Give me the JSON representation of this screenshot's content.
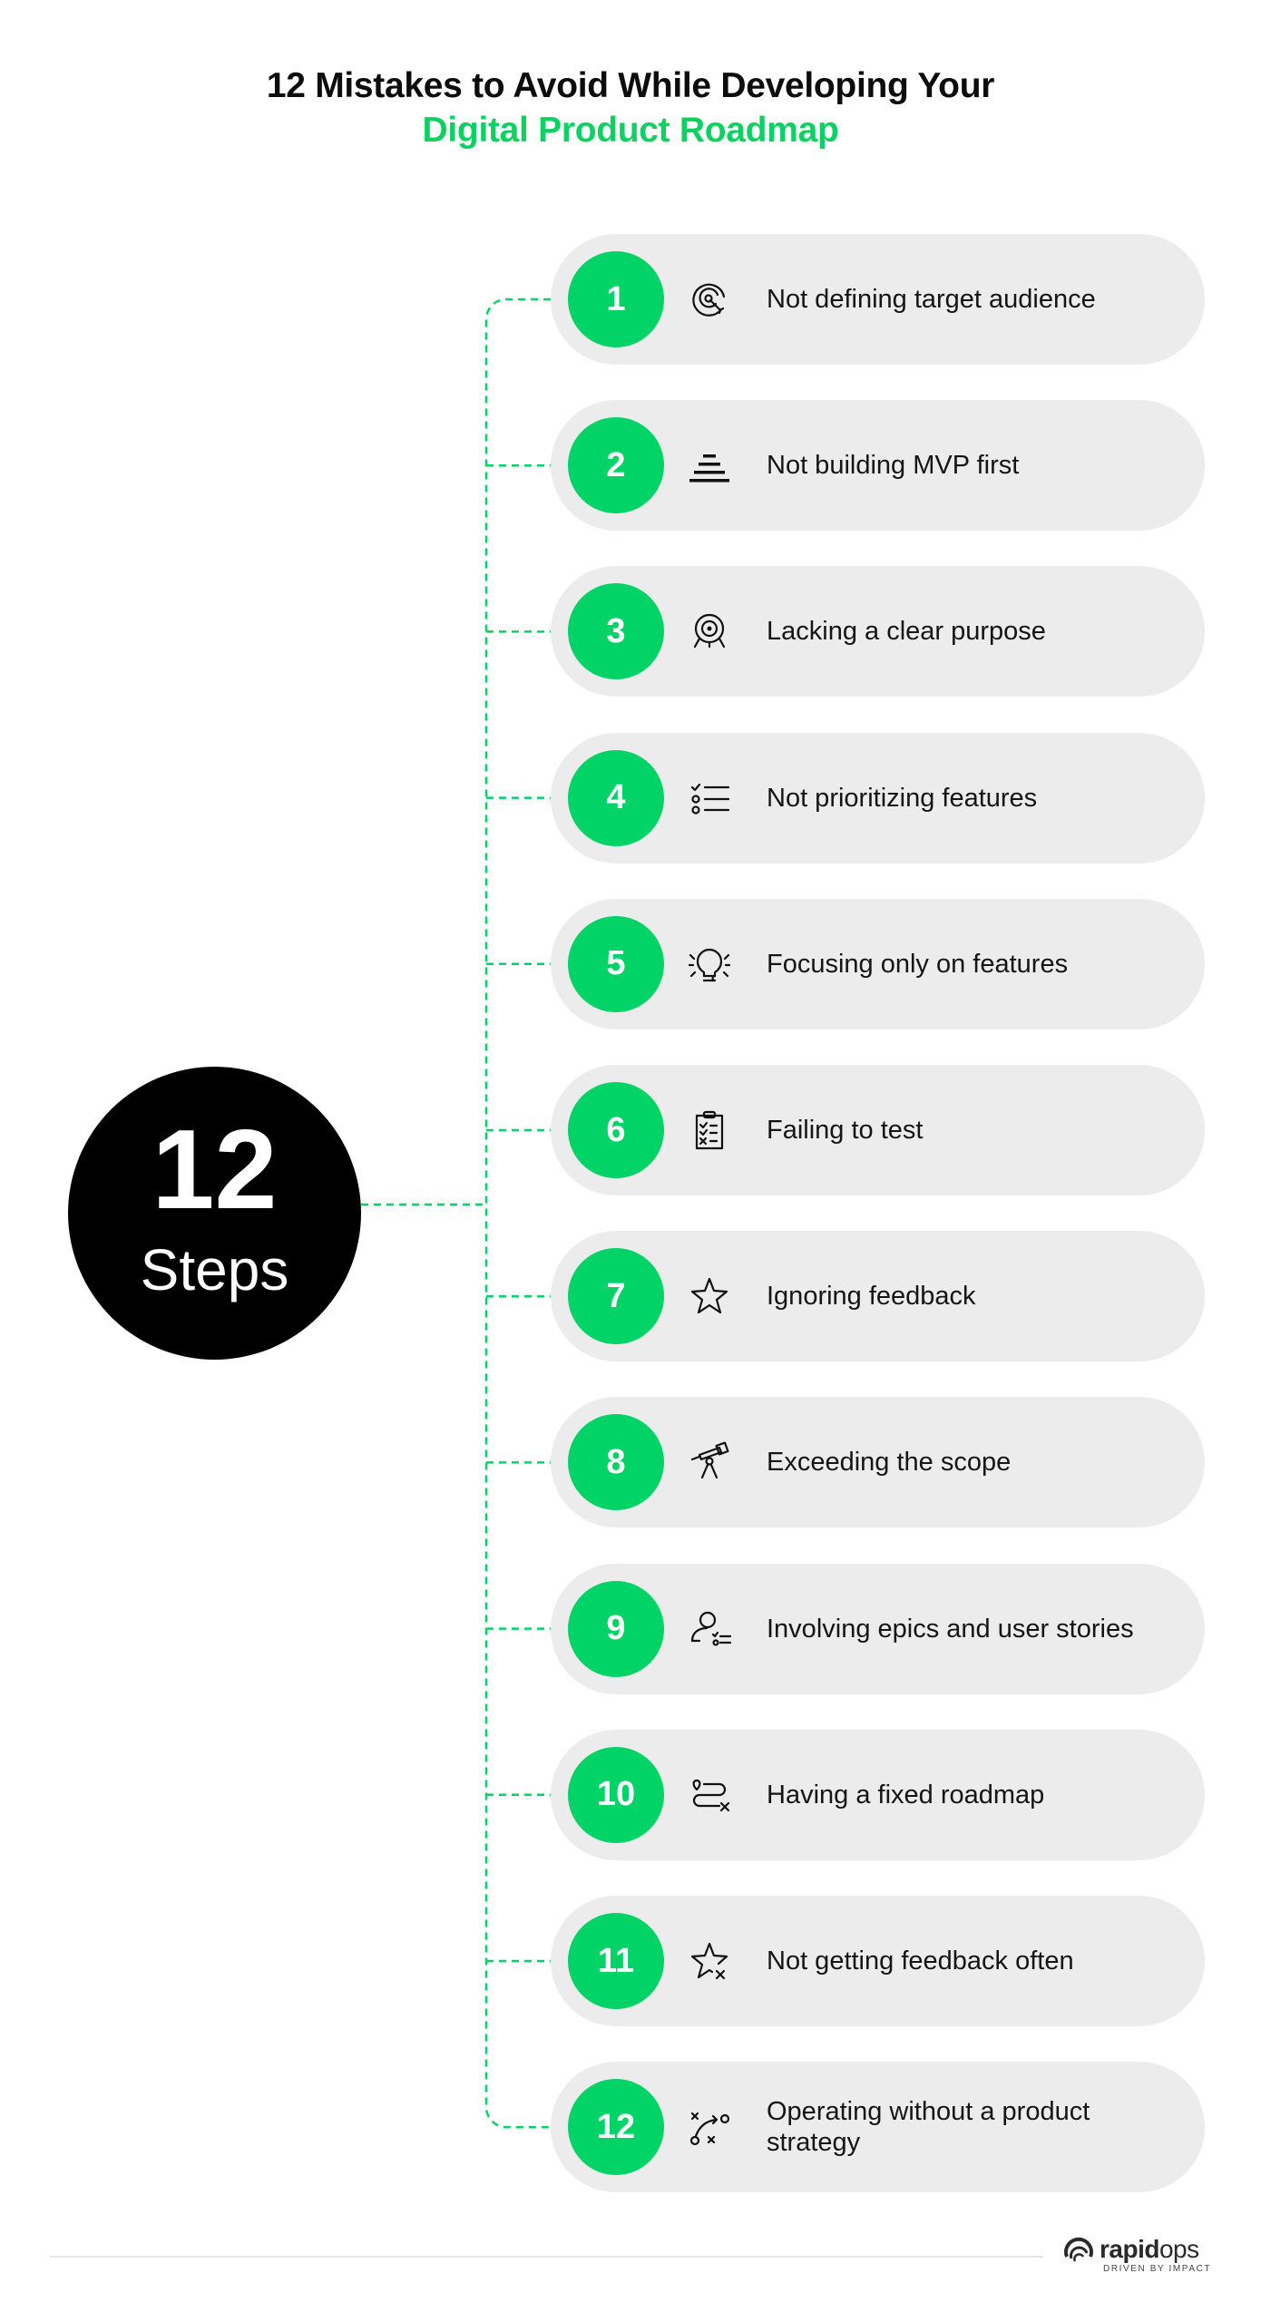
{
  "title": {
    "line1": "12 Mistakes to Avoid While Developing Your",
    "line2": "Digital Product Roadmap"
  },
  "hub": {
    "number": "12",
    "label": "Steps"
  },
  "colors": {
    "accent": "#02d367",
    "title_accent": "#0fd163",
    "pill_bg": "#ececec",
    "hub_bg": "#000000"
  },
  "steps": [
    {
      "number": "1",
      "icon": "target-audience-icon",
      "label": "Not defining target audience"
    },
    {
      "number": "2",
      "icon": "pyramid-layers-icon",
      "label": "Not building MVP first"
    },
    {
      "number": "3",
      "icon": "target-stand-icon",
      "label": "Lacking a clear purpose"
    },
    {
      "number": "4",
      "icon": "checklist-icon",
      "label": "Not prioritizing features"
    },
    {
      "number": "5",
      "icon": "lightbulb-icon",
      "label": "Focusing only on features"
    },
    {
      "number": "6",
      "icon": "clipboard-check-icon",
      "label": "Failing to test"
    },
    {
      "number": "7",
      "icon": "star-icon",
      "label": "Ignoring feedback"
    },
    {
      "number": "8",
      "icon": "telescope-icon",
      "label": "Exceeding the scope"
    },
    {
      "number": "9",
      "icon": "user-list-icon",
      "label": "Involving epics and user stories"
    },
    {
      "number": "10",
      "icon": "route-icon",
      "label": "Having a fixed roadmap"
    },
    {
      "number": "11",
      "icon": "star-x-icon",
      "label": "Not getting feedback often"
    },
    {
      "number": "12",
      "icon": "strategy-play-icon",
      "label": "Operating without a product strategy"
    }
  ],
  "footer": {
    "brand_bold": "rapid",
    "brand_light": "ops",
    "tagline": "DRIVEN BY IMPACT"
  }
}
